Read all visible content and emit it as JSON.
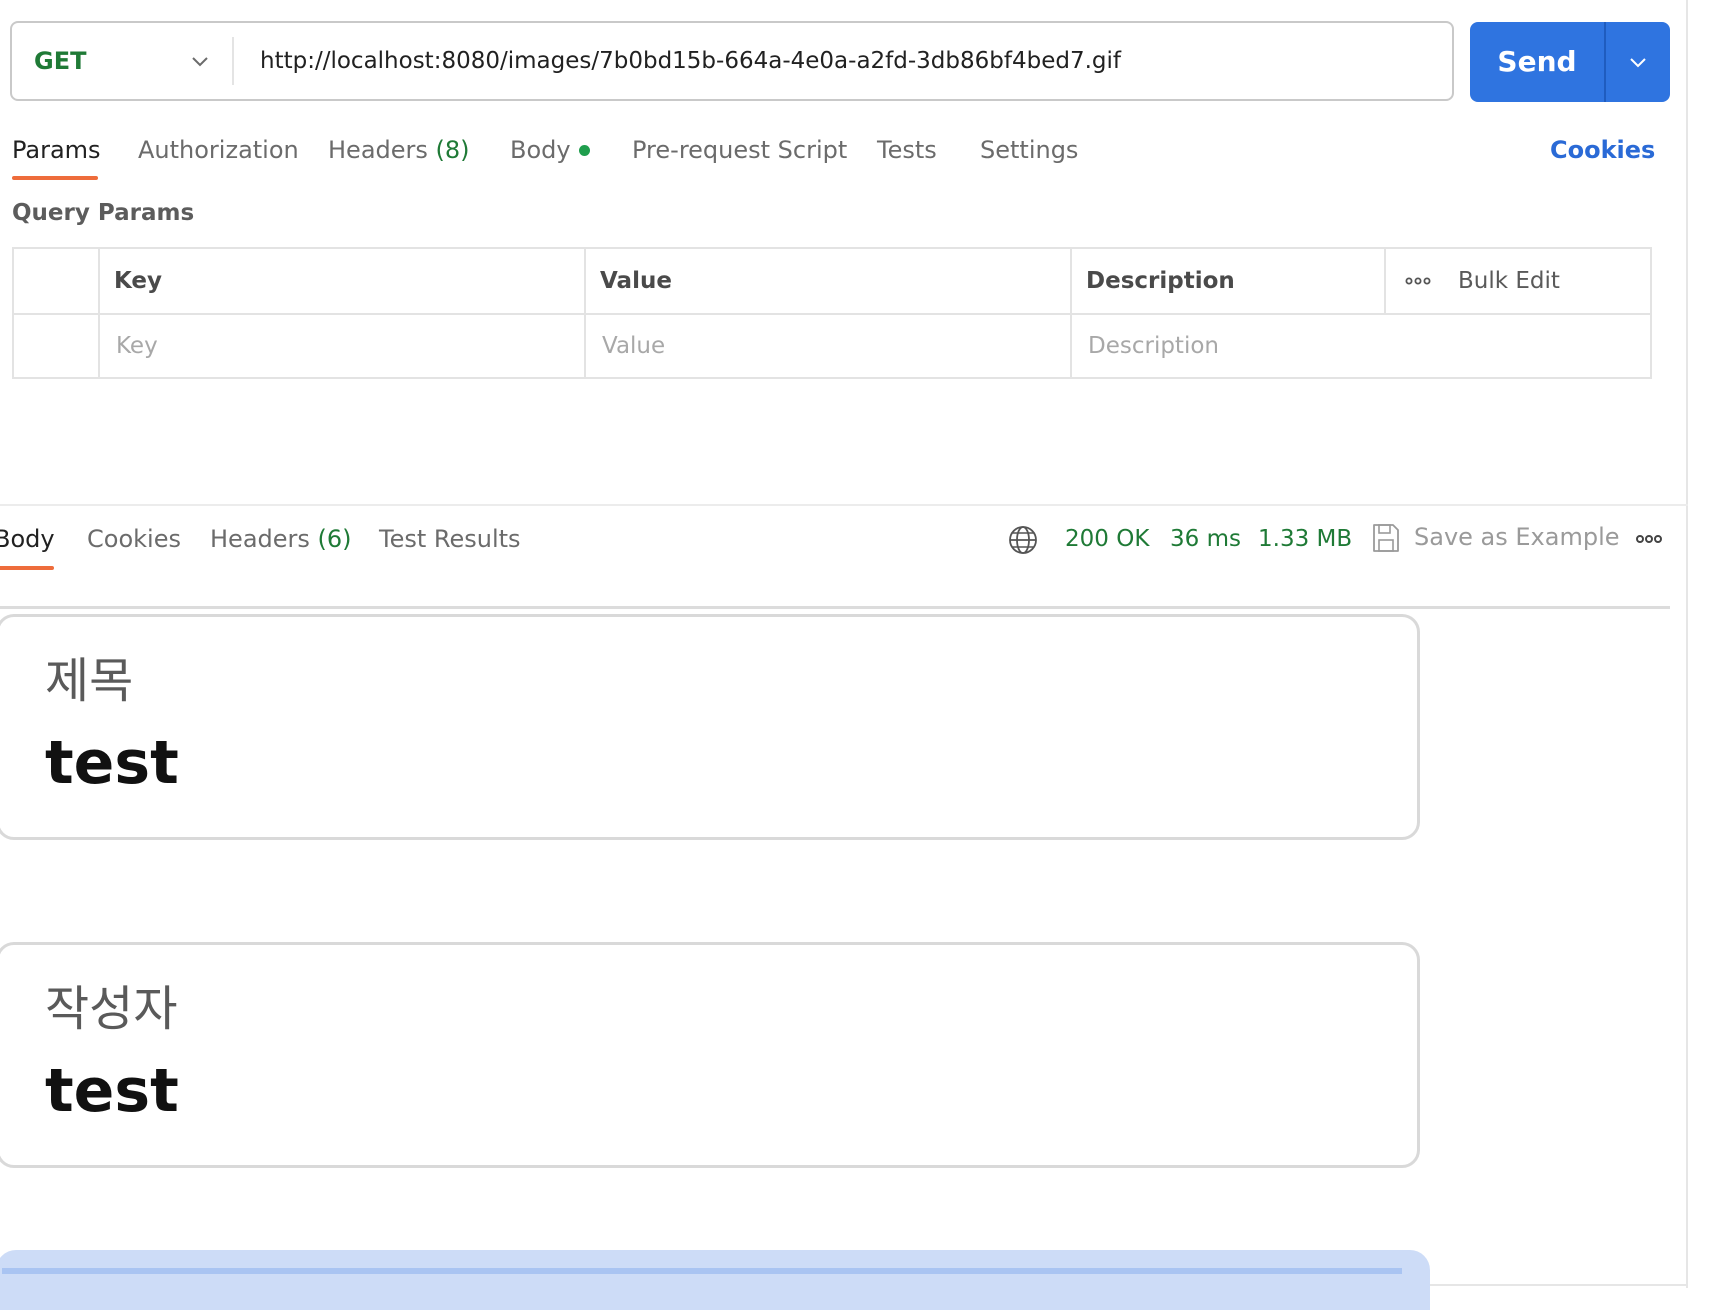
{
  "request": {
    "method": "GET",
    "url": "http://localhost:8080/images/7b0bd15b-664a-4e0a-a2fd-3db86bf4bed7.gif",
    "send_label": "Send"
  },
  "request_tabs": {
    "params": "Params",
    "authorization": "Authorization",
    "headers": "Headers",
    "headers_count": "(8)",
    "body": "Body",
    "pre_request_script": "Pre-request Script",
    "tests": "Tests",
    "settings": "Settings",
    "cookies": "Cookies"
  },
  "query_params": {
    "title": "Query Params",
    "headers": {
      "key": "Key",
      "value": "Value",
      "description": "Description"
    },
    "bulk_edit": "Bulk Edit",
    "placeholders": {
      "key": "Key",
      "value": "Value",
      "description": "Description"
    }
  },
  "response": {
    "tabs": {
      "body": "Body",
      "cookies": "Cookies",
      "headers": "Headers",
      "headers_count": "(6)",
      "test_results": "Test Results"
    },
    "status": "200 OK",
    "time": "36 ms",
    "size": "1.33 MB",
    "save_as_example": "Save as Example",
    "preview_cards": [
      {
        "label": "제목",
        "value": "test"
      },
      {
        "label": "작성자",
        "value": "test"
      }
    ]
  },
  "colors": {
    "accent": "#2f74e0",
    "success": "#1f7a36",
    "tab_indicator": "#ee6c3b",
    "link": "#2a6ad6"
  },
  "icons": [
    "chevron-down-icon",
    "more-horizontal-icon",
    "globe-icon",
    "save-icon"
  ]
}
